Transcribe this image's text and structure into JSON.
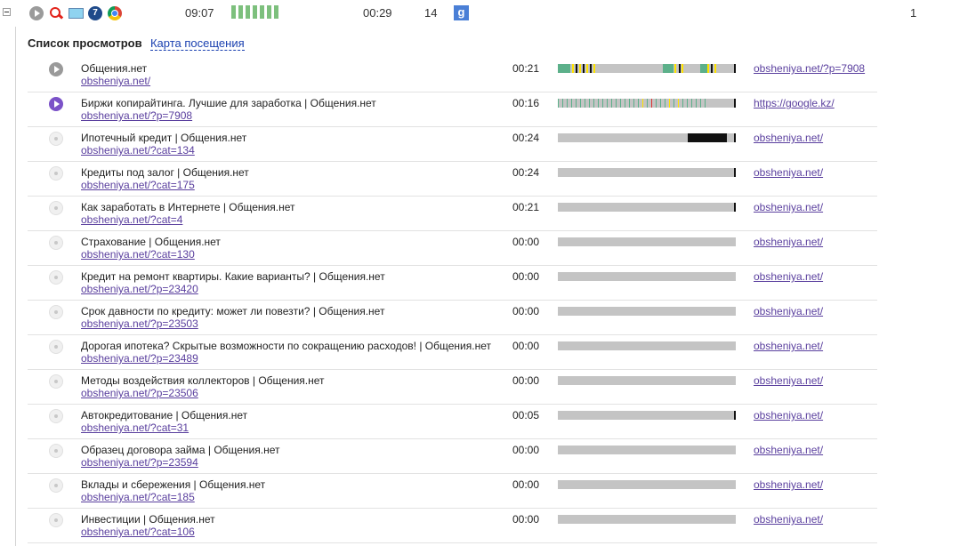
{
  "summary": {
    "time": "09:07",
    "duration": "00:29",
    "pageviews": "14",
    "count": "1",
    "icons": [
      "play-icon",
      "search-icon",
      "screen-icon",
      "windows7-icon",
      "chrome-icon",
      "google-icon"
    ],
    "google_label": "g",
    "windows_label": "7"
  },
  "section": {
    "title": "Список просмотров",
    "map_link": "Карта посещения"
  },
  "colors": {
    "timeline_bg": "#c4c4c4",
    "green": "#5cb08a",
    "yellow": "#ffe400",
    "black": "#111111",
    "red": "#d33",
    "link": "#5a3f9e",
    "accent_purple": "#7b52c8"
  },
  "rows": [
    {
      "icon": "gray-play-icon",
      "title": "Общения.нет",
      "url": "obsheniya.net/",
      "duration": "00:21",
      "referrer": "obsheniya.net/?p=7908",
      "timeline": "colorful"
    },
    {
      "icon": "purple-play-icon",
      "title": "Биржи копирайтинга. Лучшие для заработка | Общения.нет",
      "url": "obsheniya.net/?p=7908",
      "duration": "00:16",
      "referrer": "https://google.kz/",
      "timeline": "striped"
    },
    {
      "icon": "dot-icon",
      "title": "Ипотечный кредит | Общения.нет",
      "url": "obsheniya.net/?cat=134",
      "duration": "00:24",
      "referrer": "obsheniya.net/",
      "timeline": "black-block"
    },
    {
      "icon": "dot-icon",
      "title": "Кредиты под залог | Общения.нет",
      "url": "obsheniya.net/?cat=175",
      "duration": "00:24",
      "referrer": "obsheniya.net/",
      "timeline": "endmark"
    },
    {
      "icon": "dot-icon",
      "title": "Как заработать в Интернете | Общения.нет",
      "url": "obsheniya.net/?cat=4",
      "duration": "00:21",
      "referrer": "obsheniya.net/",
      "timeline": "endmark"
    },
    {
      "icon": "dot-icon",
      "title": "Страхование | Общения.нет",
      "url": "obsheniya.net/?cat=130",
      "duration": "00:00",
      "referrer": "obsheniya.net/",
      "timeline": "plain"
    },
    {
      "icon": "dot-icon",
      "title": "Кредит на ремонт квартиры. Какие варианты? | Общения.нет",
      "url": "obsheniya.net/?p=23420",
      "duration": "00:00",
      "referrer": "obsheniya.net/",
      "timeline": "plain"
    },
    {
      "icon": "dot-icon",
      "title": "Срок давности по кредиту: может ли повезти? | Общения.нет",
      "url": "obsheniya.net/?p=23503",
      "duration": "00:00",
      "referrer": "obsheniya.net/",
      "timeline": "plain"
    },
    {
      "icon": "dot-icon",
      "title": "Дорогая ипотека? Скрытые возможности по сокращению расходов! | Общения.нет",
      "url": "obsheniya.net/?p=23489",
      "duration": "00:00",
      "referrer": "obsheniya.net/",
      "timeline": "plain"
    },
    {
      "icon": "dot-icon",
      "title": "Методы воздействия коллекторов | Общения.нет",
      "url": "obsheniya.net/?p=23506",
      "duration": "00:00",
      "referrer": "obsheniya.net/",
      "timeline": "plain"
    },
    {
      "icon": "dot-icon",
      "title": "Автокредитование | Общения.нет",
      "url": "obsheniya.net/?cat=31",
      "duration": "00:05",
      "referrer": "obsheniya.net/",
      "timeline": "endmark"
    },
    {
      "icon": "dot-icon",
      "title": "Образец договора займа | Общения.нет",
      "url": "obsheniya.net/?p=23594",
      "duration": "00:00",
      "referrer": "obsheniya.net/",
      "timeline": "plain"
    },
    {
      "icon": "dot-icon",
      "title": "Вклады и сбережения | Общения.нет",
      "url": "obsheniya.net/?cat=185",
      "duration": "00:00",
      "referrer": "obsheniya.net/",
      "timeline": "plain"
    },
    {
      "icon": "dot-icon",
      "title": "Инвестиции | Общения.нет",
      "url": "obsheniya.net/?cat=106",
      "duration": "00:00",
      "referrer": "obsheniya.net/",
      "timeline": "plain"
    }
  ]
}
